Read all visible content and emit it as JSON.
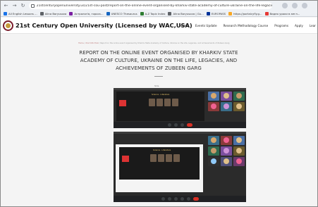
{
  "browser": {
    "url": "21stcenturyopenuniversity.us/21st-cou-post/report-on-the-online-event-organised-by-kharkiv-state-academy-of-culture-ukraine-on-the-life-legacies-and-achieve..."
  },
  "bookmarks": [
    {
      "label": "All English Lessons ...",
      "color": "#1a73e8"
    },
    {
      "label": "Alina Boryusova",
      "color": "#5f6368"
    },
    {
      "label": "Астрологія, гороск...",
      "color": "#7b1fa2"
    },
    {
      "label": "UNESCO Thesaurus",
      "color": "#1565c0"
    },
    {
      "label": "A-Z Topic Index",
      "color": "#2e7d32"
    },
    {
      "label": "Alina Boryusova | Gu...",
      "color": "#5f6368"
    },
    {
      "label": "EUROPASS",
      "color": "#003399"
    },
    {
      "label": "https://portalcyfly.g...",
      "color": "#f9a825"
    },
    {
      "label": "Видео уроки в англ...",
      "color": "#e53935"
    }
  ],
  "site": {
    "title": "21st Century Open University (Licensed by WAC,USA)",
    "nav": [
      "Home",
      "Events Update",
      "Research Methodology Course",
      "Programs",
      "Apply",
      "Lear"
    ]
  },
  "article": {
    "breadcrumb_home": "Home",
    "breadcrumb_section": "21st COU Post",
    "breadcrumb_current": "Report on the online event organised by Kharkiv State Academy of Culture, Ukraine on the Life, Legacies, and Achievements of Zubeen Garg",
    "title": "REPORT ON THE ONLINE EVENT ORGANISED BY KHARKIV STATE ACADEMY OF CULTURE, UKRAINE ON THE LIFE, LEGACIES, AND ACHIEVEMENTS OF ZUBEEN GARG",
    "caption": "Slide"
  },
  "screenshots": [
    {
      "slide_heading": "Science · Literature",
      "tile_colors": [
        "#4a6fa5",
        "#7b4f9e",
        "#2f6b4f",
        "#8a3a3a",
        "#3a6e8a",
        "#6b5b2e",
        "#50507a",
        "#2f2f2f",
        "#6b3a6b"
      ]
    },
    {
      "slide_heading": "Science · Literature",
      "tile_colors": [
        "#3a6e8a",
        "#8a3a3a",
        "#4a6fa5",
        "#2f6b4f",
        "#7b4f9e",
        "#6b5b2e",
        "#2f2f2f",
        "#50507a",
        "#6b3a6b"
      ]
    }
  ]
}
